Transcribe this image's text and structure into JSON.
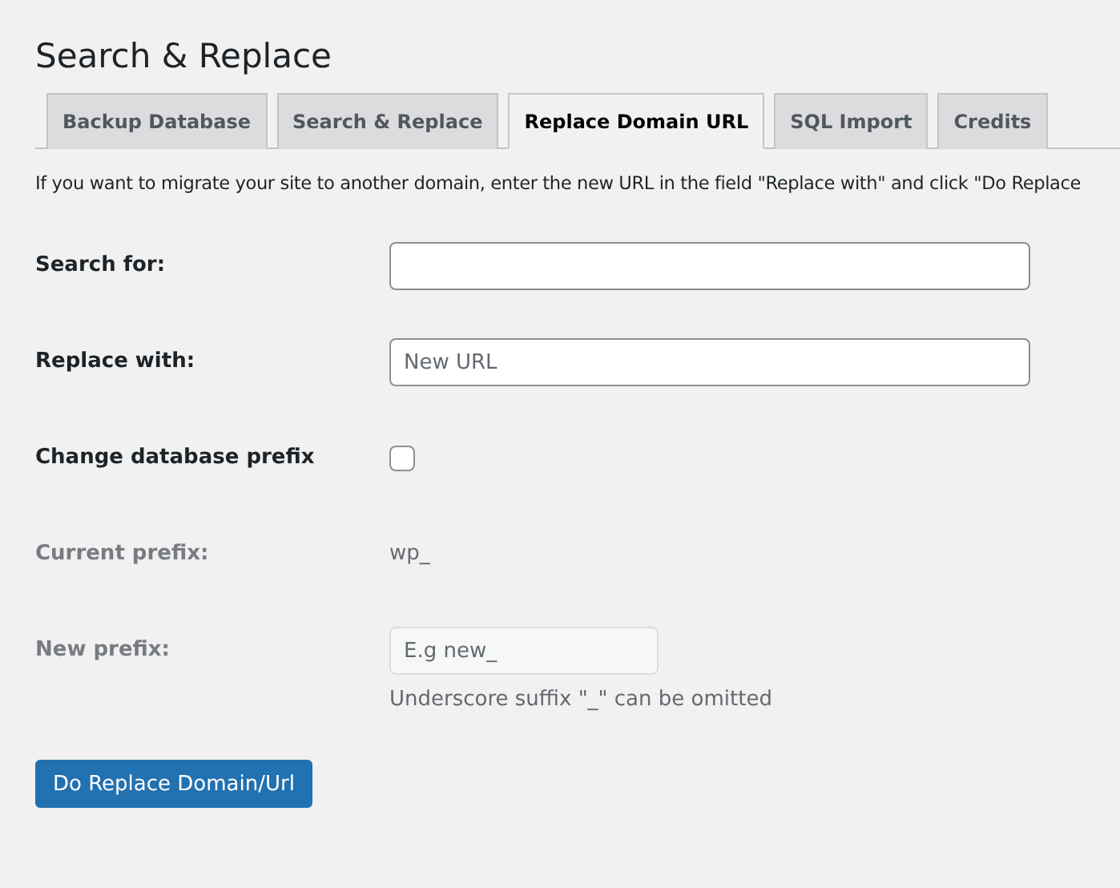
{
  "title": "Search & Replace",
  "tabs": [
    {
      "label": "Backup Database",
      "selected": false
    },
    {
      "label": "Search & Replace",
      "selected": false
    },
    {
      "label": "Replace Domain URL",
      "selected": true
    },
    {
      "label": "SQL Import",
      "selected": false
    },
    {
      "label": "Credits",
      "selected": false
    }
  ],
  "intro": "If you want to migrate your site to another domain, enter the new URL in the field \"Replace with\" and click \"Do Replace",
  "rows": [
    {
      "kind": "text",
      "label": "Search for:",
      "disabled": false
    },
    {
      "kind": "text",
      "label": "Replace with:",
      "placeholder": "New URL",
      "disabled": false
    },
    {
      "kind": "checkbox",
      "label": "Change database prefix",
      "checked": false,
      "disabled": false
    },
    {
      "kind": "static",
      "label": "Current prefix:",
      "value": "wp_",
      "disabled": true
    },
    {
      "kind": "short",
      "label": "New prefix:",
      "placeholder": "E.g new_",
      "hint": "Underscore suffix \"_\" can be omitted",
      "disabled": true
    }
  ],
  "submit": "Do Replace Domain/Url"
}
